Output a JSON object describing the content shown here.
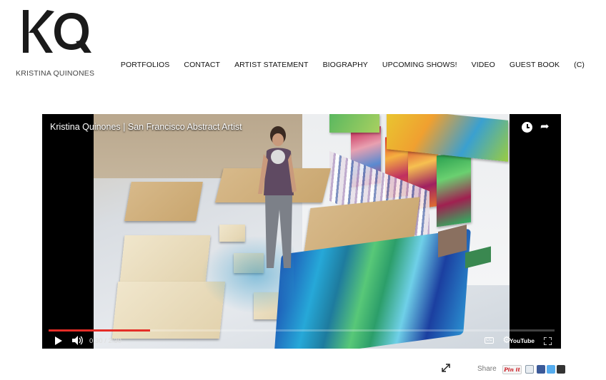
{
  "brand": {
    "logo_letters": "KQ",
    "name": "KRISTINA QUINONES"
  },
  "nav": {
    "items": [
      {
        "label": "PORTFOLIOS"
      },
      {
        "label": "CONTACT"
      },
      {
        "label": "ARTIST STATEMENT"
      },
      {
        "label": "BIOGRAPHY"
      },
      {
        "label": "UPCOMING SHOWS!"
      },
      {
        "label": "VIDEO"
      },
      {
        "label": "GUEST BOOK"
      },
      {
        "label": "(C)"
      }
    ]
  },
  "video": {
    "title": "Kristina Quinones | San Francisco Abstract Artist",
    "current_time": "0:30",
    "duration": "2:30",
    "time_display": "0:30 / 2:30",
    "progress_fraction": 0.2,
    "cc_label": "CC",
    "youtube_label": "YouTube",
    "icons": [
      "watch-later-icon",
      "share-icon",
      "play-icon",
      "volume-icon",
      "settings-icon",
      "fullscreen-icon"
    ],
    "accent_color": "#e52d27"
  },
  "share_bar": {
    "label": "Share",
    "pinterest_label": "Pin it",
    "icons": [
      "expand-icon",
      "email-icon",
      "facebook-icon",
      "twitter-icon",
      "addthis-icon"
    ]
  }
}
